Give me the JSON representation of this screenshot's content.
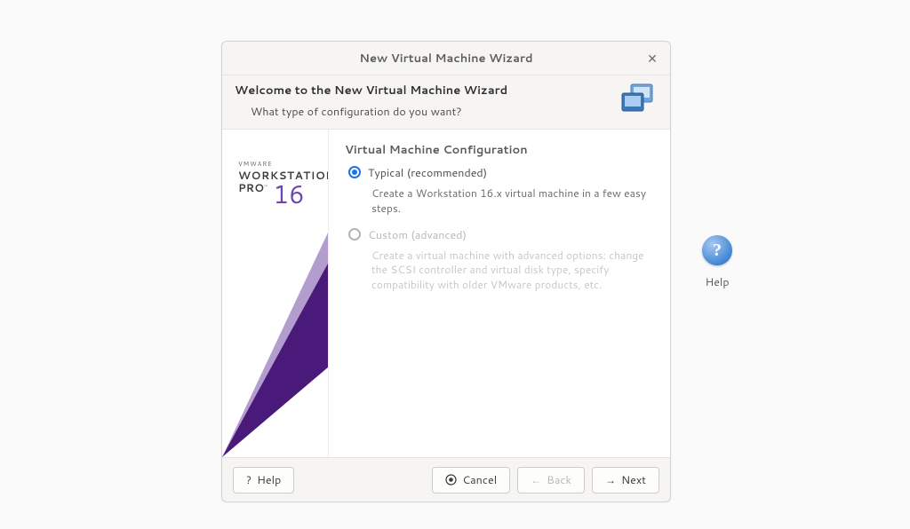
{
  "dialog": {
    "title": "New Virtual Machine Wizard",
    "welcome_title": "Welcome to the New Virtual Machine Wizard",
    "welcome_sub": "What type of configuration do you want?"
  },
  "brand": {
    "company": "VMWARE",
    "product": "WORKSTATION",
    "edition": "PRO",
    "tm": "™",
    "version": "16"
  },
  "config": {
    "heading": "Virtual Machine Configuration",
    "options": [
      {
        "label": "Typical (recommended)",
        "desc": "Create a Workstation 16.x virtual machine in a few easy steps.",
        "selected": true,
        "enabled": true
      },
      {
        "label": "Custom (advanced)",
        "desc": "Create a virtual machine with advanced options: change the SCSI controller and virtual disk type, specify compatibility with older VMware products, etc.",
        "selected": false,
        "enabled": false
      }
    ]
  },
  "footer": {
    "help": "Help",
    "cancel": "Cancel",
    "back": "Back",
    "next": "Next"
  },
  "desktop": {
    "help_label": "Help"
  },
  "glyphs": {
    "question": "?",
    "cancel": "⦿",
    "back": "←",
    "next": "→"
  }
}
